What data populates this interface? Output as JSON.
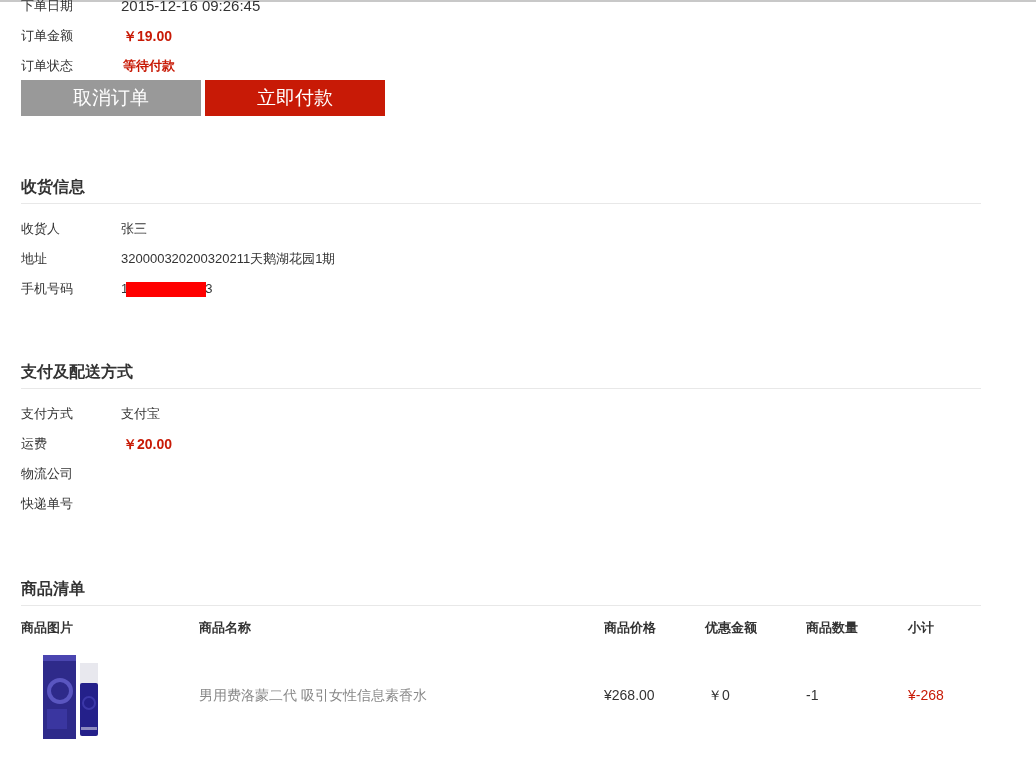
{
  "order_info": [
    {
      "label": "下单日期",
      "value": "2015-12-16 09:26:45",
      "kind": "plain"
    },
    {
      "label": "订单金额",
      "value": "￥19.00",
      "kind": "price"
    },
    {
      "label": "订单状态",
      "value": "等待付款",
      "kind": "status"
    }
  ],
  "buttons": [
    {
      "label": "取消订单",
      "kind": "secondary"
    },
    {
      "label": "立即付款",
      "kind": "primary"
    }
  ],
  "sections": [
    {
      "title": "收货信息",
      "rows": [
        {
          "label": "收货人",
          "value": "张三",
          "kind": "plain"
        },
        {
          "label": "地址",
          "value": "320000320200320211天鹅湖花园1期",
          "kind": "plain"
        },
        {
          "label": "手机号码",
          "value_start": "1",
          "value_end": "3",
          "kind": "redacted"
        }
      ]
    },
    {
      "title": "支付及配送方式",
      "rows": [
        {
          "label": "支付方式",
          "value": "支付宝",
          "kind": "plain"
        },
        {
          "label": "运费",
          "value": "￥20.00",
          "kind": "price"
        },
        {
          "label": "物流公司",
          "kind": "plain"
        },
        {
          "label": "快递单号",
          "kind": "plain"
        }
      ]
    }
  ],
  "goods": {
    "title": "商品清单",
    "columns": [
      "商品图片",
      "商品名称",
      "商品价格",
      "优惠金额",
      "商品数量",
      "小计"
    ],
    "rows": [
      {
        "name": "男用费洛蒙二代 吸引女性信息素香水",
        "price": "¥268.00",
        "discount": "￥0",
        "quantity": "-1",
        "subtotal": "¥-268"
      }
    ]
  }
}
